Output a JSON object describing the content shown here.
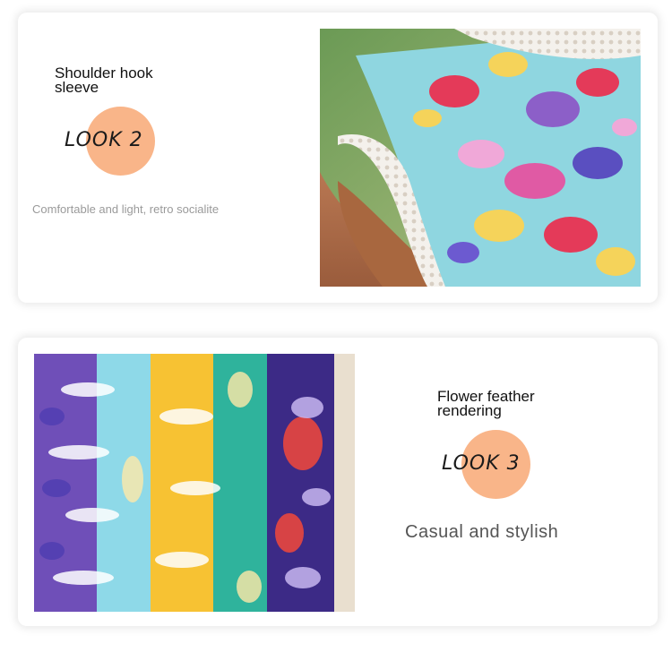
{
  "features": [
    {
      "title": "Shoulder hook sleeve",
      "look_label": "LOOK 2",
      "caption": "Comfortable and light, retro socialite",
      "accent_color": "#f9b589"
    },
    {
      "title": "Flower feather rendering",
      "look_label": "LOOK 3",
      "caption": "Casual and stylish",
      "accent_color": "#f9b589"
    }
  ]
}
